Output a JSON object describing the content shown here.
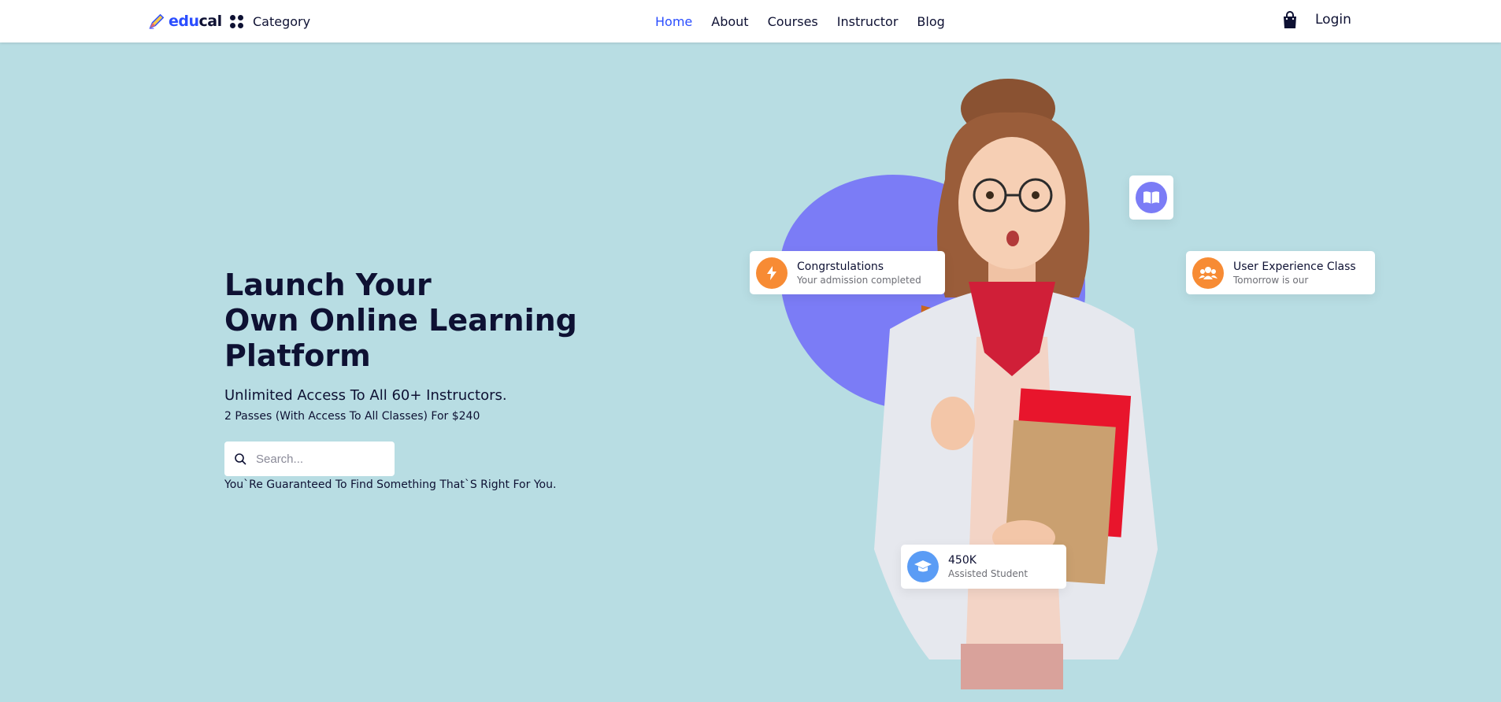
{
  "header": {
    "logo": {
      "edu": "edu",
      "cal": "cal"
    },
    "category_label": "Category",
    "nav": [
      {
        "label": "Home",
        "active": true
      },
      {
        "label": "About",
        "active": false
      },
      {
        "label": "Courses",
        "active": false
      },
      {
        "label": "Instructor",
        "active": false
      },
      {
        "label": "Blog",
        "active": false
      }
    ],
    "login_label": "Login"
  },
  "hero": {
    "title_lines": [
      "Launch Your",
      "Own Online Learning",
      "Platform"
    ],
    "subtitle": "Unlimited Access To All 60+ Instructors.",
    "passes": "2 Passes (With Access To All Classes) For $240",
    "search": {
      "placeholder": "Search...",
      "value": ""
    },
    "guarantee": "You`Re Guaranteed To Find Something That`S Right For You."
  },
  "cards": {
    "congrats": {
      "title": "Congrstulations",
      "subtitle": "Your admission completed",
      "icon": "lightning-icon"
    },
    "ux_class": {
      "title": "User Experience Class",
      "subtitle": "Tomorrow is our",
      "icon": "users-icon"
    },
    "students": {
      "title": "450K",
      "subtitle": "Assisted Student",
      "icon": "graduation-cap-icon"
    },
    "book": {
      "icon": "open-book-icon"
    }
  },
  "colors": {
    "background": "#b8dde3",
    "accent_blue": "#2b4eff",
    "blob_purple": "#7b7cf6",
    "orange": "#f78b34",
    "student_blue": "#5a9cf5",
    "dark_text": "#0e1133"
  }
}
